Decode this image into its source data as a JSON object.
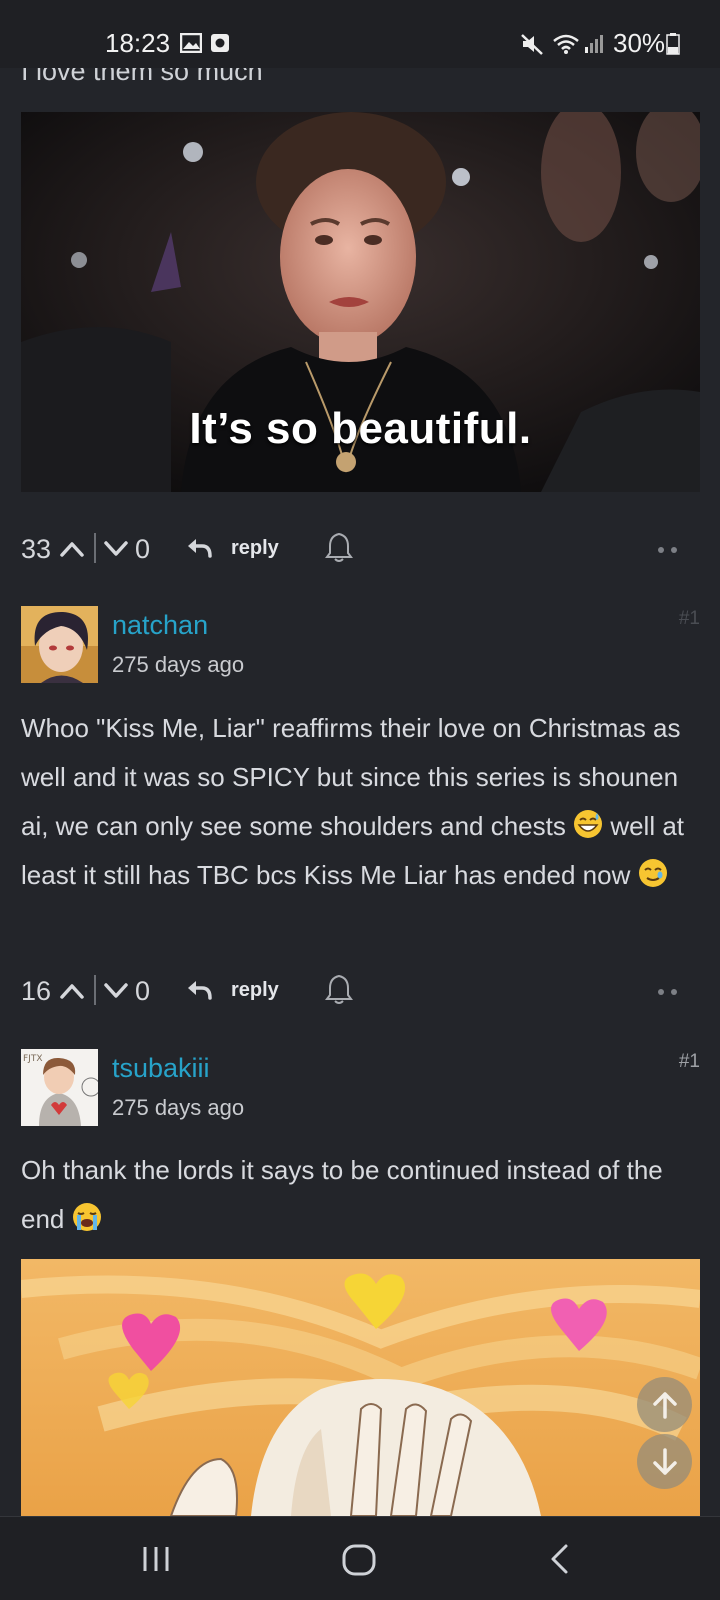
{
  "status_bar": {
    "time": "18:23",
    "battery": "30%",
    "icons": [
      "gallery-icon",
      "screen-record-icon",
      "mute-icon",
      "wifi-icon",
      "signal-icon",
      "battery-icon"
    ]
  },
  "previous_comment": {
    "cut_text": "I love them so much",
    "image_caption": "It’s so beautiful.",
    "upvotes": "33",
    "downvotes": "0",
    "reply_label": "reply"
  },
  "comments": [
    {
      "username": "natchan",
      "date": "275 days ago",
      "number": "#1",
      "text_parts": [
        "Whoo \"Kiss Me, Liar\" reaffirms their love on Christmas as well and it was so SPICY but since this series is shounen ai, we can only see some shoulders and chests",
        " well at least it still has TBC bcs Kiss Me Liar has ended now"
      ],
      "emojis": [
        "grinning-sweat-emoji",
        "smiling-tear-emoji"
      ],
      "upvotes": "16",
      "downvotes": "0",
      "reply_label": "reply"
    },
    {
      "username": "tsubakiii",
      "date": "275 days ago",
      "number": "#1",
      "text": "Oh thank the lords it says to be continued instead of the end",
      "emojis": [
        "loudly-crying-emoji"
      ]
    }
  ],
  "colors": {
    "background": "#23252a",
    "username": "#27a3c9",
    "text": "#d8dadf"
  }
}
